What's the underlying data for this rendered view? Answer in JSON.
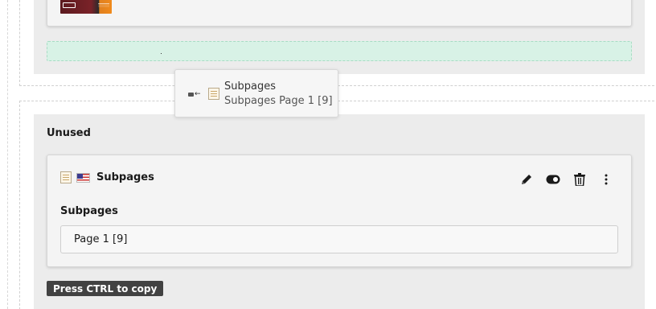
{
  "unused_column": {
    "title": "Unused"
  },
  "content_element": {
    "title": "Subpages",
    "field_label": "Subpages",
    "field_value": "Page 1 [9]",
    "actions": [
      "edit-icon",
      "toggle-icon",
      "trash-icon",
      "more-vertical-icon"
    ]
  },
  "copy_hint": "Press CTRL to copy",
  "drag_tooltip": {
    "title": "Subpages",
    "subtitle": "Subpages Page 1 [9]"
  }
}
